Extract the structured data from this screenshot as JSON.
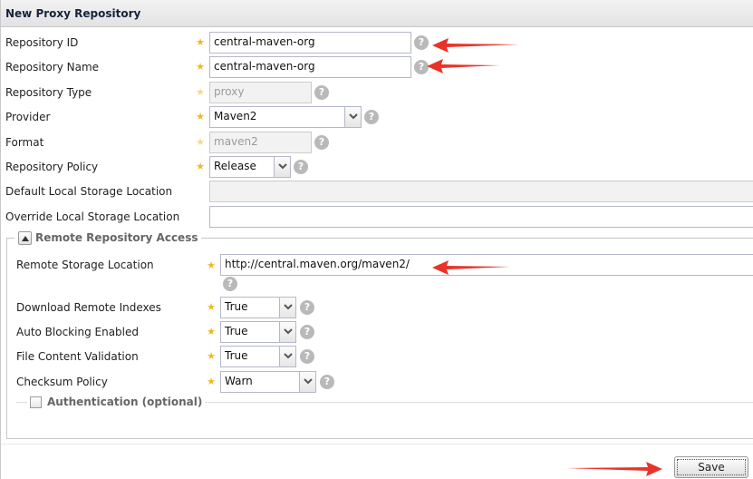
{
  "panel_title": "New Proxy Repository",
  "fields": {
    "repo_id": {
      "label": "Repository ID",
      "value": "central-maven-org"
    },
    "repo_name": {
      "label": "Repository Name",
      "value": "central-maven-org"
    },
    "repo_type": {
      "label": "Repository Type",
      "value": "proxy"
    },
    "provider": {
      "label": "Provider",
      "value": "Maven2"
    },
    "format": {
      "label": "Format",
      "value": "maven2"
    },
    "policy": {
      "label": "Repository Policy",
      "value": "Release"
    },
    "default_storage": {
      "label": "Default Local Storage Location",
      "value": ""
    },
    "override_storage": {
      "label": "Override Local Storage Location",
      "value": ""
    }
  },
  "remote_section": {
    "title": "Remote Repository Access",
    "remote_url": {
      "label": "Remote Storage Location",
      "value": "http://central.maven.org/maven2/"
    },
    "download_indexes": {
      "label": "Download Remote Indexes",
      "value": "True"
    },
    "auto_blocking": {
      "label": "Auto Blocking Enabled",
      "value": "True"
    },
    "file_validation": {
      "label": "File Content Validation",
      "value": "True"
    },
    "checksum_policy": {
      "label": "Checksum Policy",
      "value": "Warn"
    }
  },
  "auth_section": {
    "title": "Authentication (optional)"
  },
  "save_label": "Save",
  "help_glyph": "?",
  "required_glyph": "★",
  "colors": {
    "required_star": "#f0b820",
    "annotation_arrow": "#e8332a",
    "help_icon": "#b9b9b9"
  }
}
